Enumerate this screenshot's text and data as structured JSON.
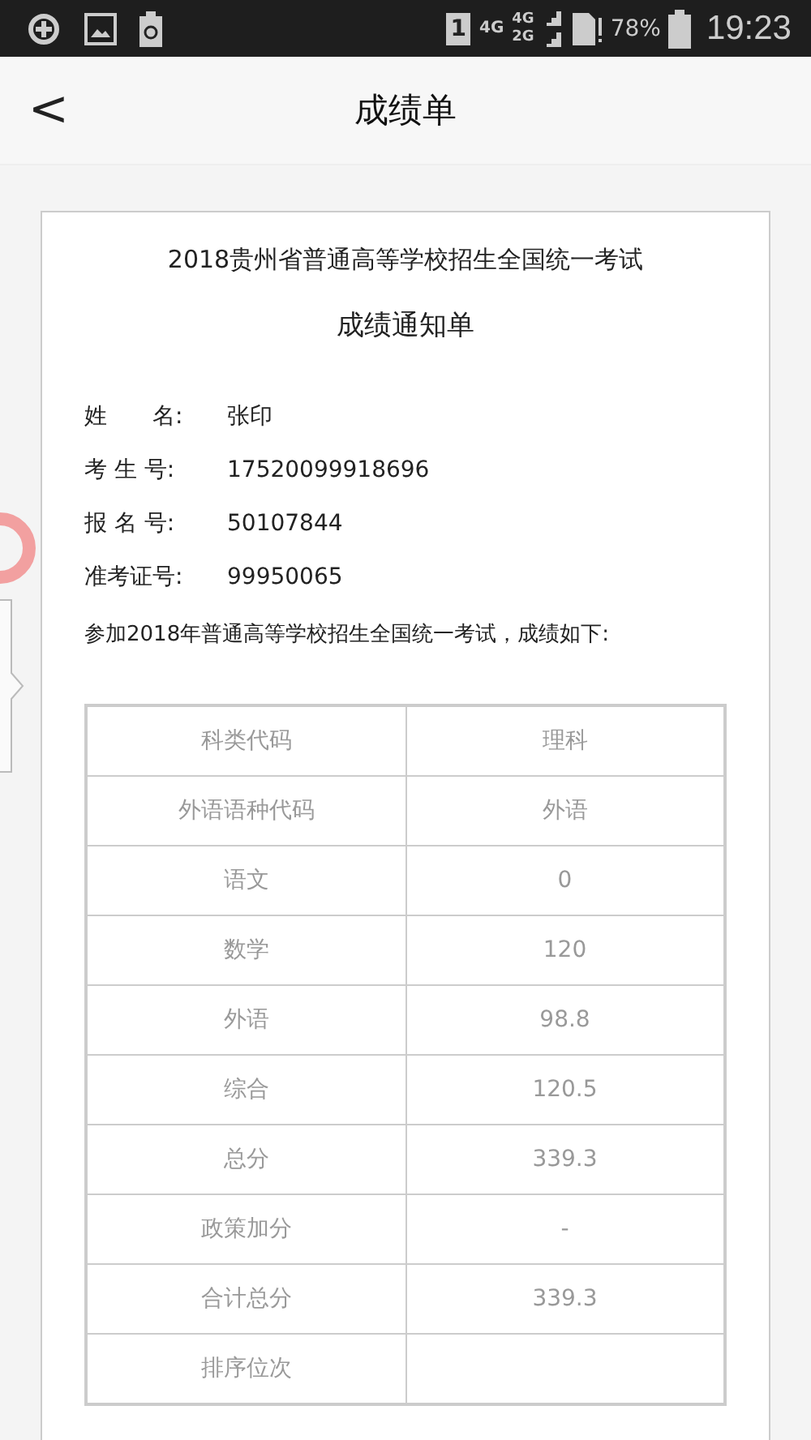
{
  "status_bar": {
    "sim": "1",
    "network_top": "4G",
    "network_a": "4G",
    "network_b": "2G",
    "battery": "78%",
    "time": "19:23"
  },
  "header": {
    "back": "<",
    "title": "成绩单"
  },
  "document": {
    "heading": "2018贵州省普通高等学校招生全国统一考试",
    "subheading": "成绩通知单",
    "fields": [
      {
        "label": "姓　　名:",
        "value": "张印"
      },
      {
        "label": "考 生 号:",
        "value": "17520099918696"
      },
      {
        "label": "报 名 号:",
        "value": "50107844"
      },
      {
        "label": "准考证号:",
        "value": "99950065"
      }
    ],
    "intro": "参加2018年普通高等学校招生全国统一考试，成绩如下:",
    "table": {
      "rows": [
        [
          "科类代码",
          "理科"
        ],
        [
          "外语语种代码",
          "外语"
        ],
        [
          "语文",
          "0"
        ],
        [
          "数学",
          "120"
        ],
        [
          "外语",
          "98.8"
        ],
        [
          "综合",
          "120.5"
        ],
        [
          "总分",
          "339.3"
        ],
        [
          "政策加分",
          "-"
        ],
        [
          "合计总分",
          "339.3"
        ],
        [
          "排序位次",
          ""
        ]
      ]
    }
  }
}
